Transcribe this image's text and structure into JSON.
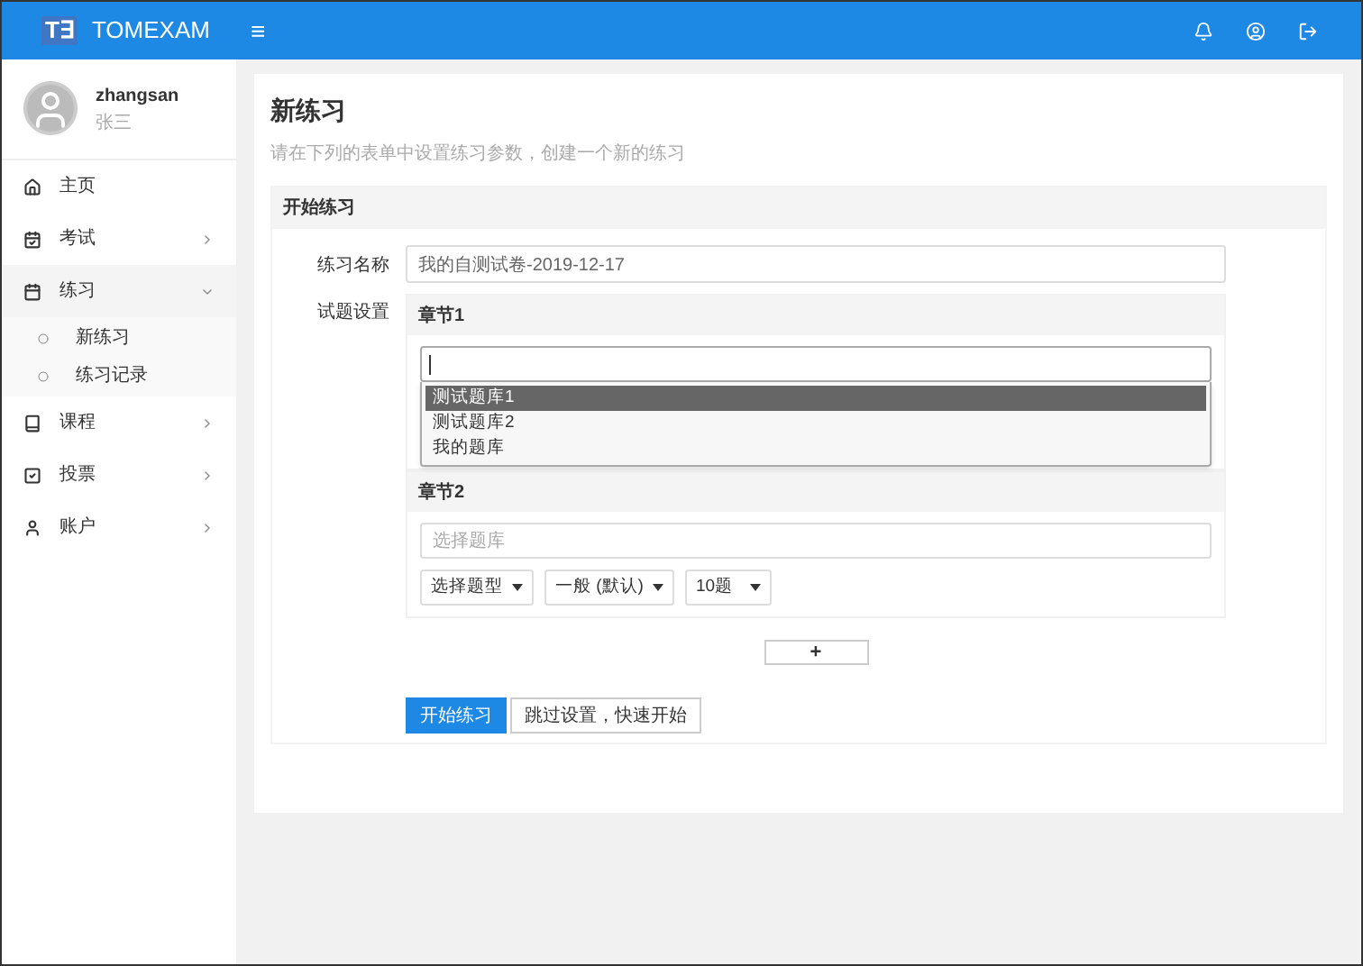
{
  "brand": {
    "logo": "T∃",
    "name": "TOMEXAM"
  },
  "topbar": {
    "menu_glyph": "≡"
  },
  "user": {
    "name": "zhangsan",
    "display_name": "张三"
  },
  "nav": [
    {
      "label": "主页",
      "kind": "home",
      "expanded": false,
      "has_children": false
    },
    {
      "label": "考试",
      "kind": "exam",
      "expanded": false,
      "has_children": true
    },
    {
      "label": "练习",
      "kind": "practice",
      "expanded": true,
      "has_children": true,
      "children": [
        {
          "label": "新练习"
        },
        {
          "label": "练习记录"
        }
      ]
    },
    {
      "label": "课程",
      "kind": "course",
      "expanded": false,
      "has_children": true
    },
    {
      "label": "投票",
      "kind": "vote",
      "expanded": false,
      "has_children": true
    },
    {
      "label": "账户",
      "kind": "account",
      "expanded": false,
      "has_children": true
    }
  ],
  "page": {
    "title": "新练习",
    "subtitle": "请在下列的表单中设置练习参数，创建一个新的练习"
  },
  "panel": {
    "title": "开始练习",
    "name_label": "练习名称",
    "name_value": "我的自测试卷-2019-12-17",
    "settings_label": "试题设置",
    "chapters": [
      {
        "title": "章节1",
        "dropdown_open": true,
        "options": [
          {
            "label": "测试题库1",
            "selected": true
          },
          {
            "label": "测试题库2",
            "selected": false
          },
          {
            "label": "我的题库",
            "selected": false
          }
        ]
      },
      {
        "title": "章节2",
        "bank_placeholder": "选择题库",
        "dropdown_open": false,
        "selects": [
          "选择题型",
          "一般 (默认)",
          "10题"
        ]
      }
    ],
    "add_label": "+",
    "buttons": [
      {
        "label": "开始练习",
        "primary": true
      },
      {
        "label": "跳过设置，快速开始",
        "primary": false
      }
    ]
  }
}
